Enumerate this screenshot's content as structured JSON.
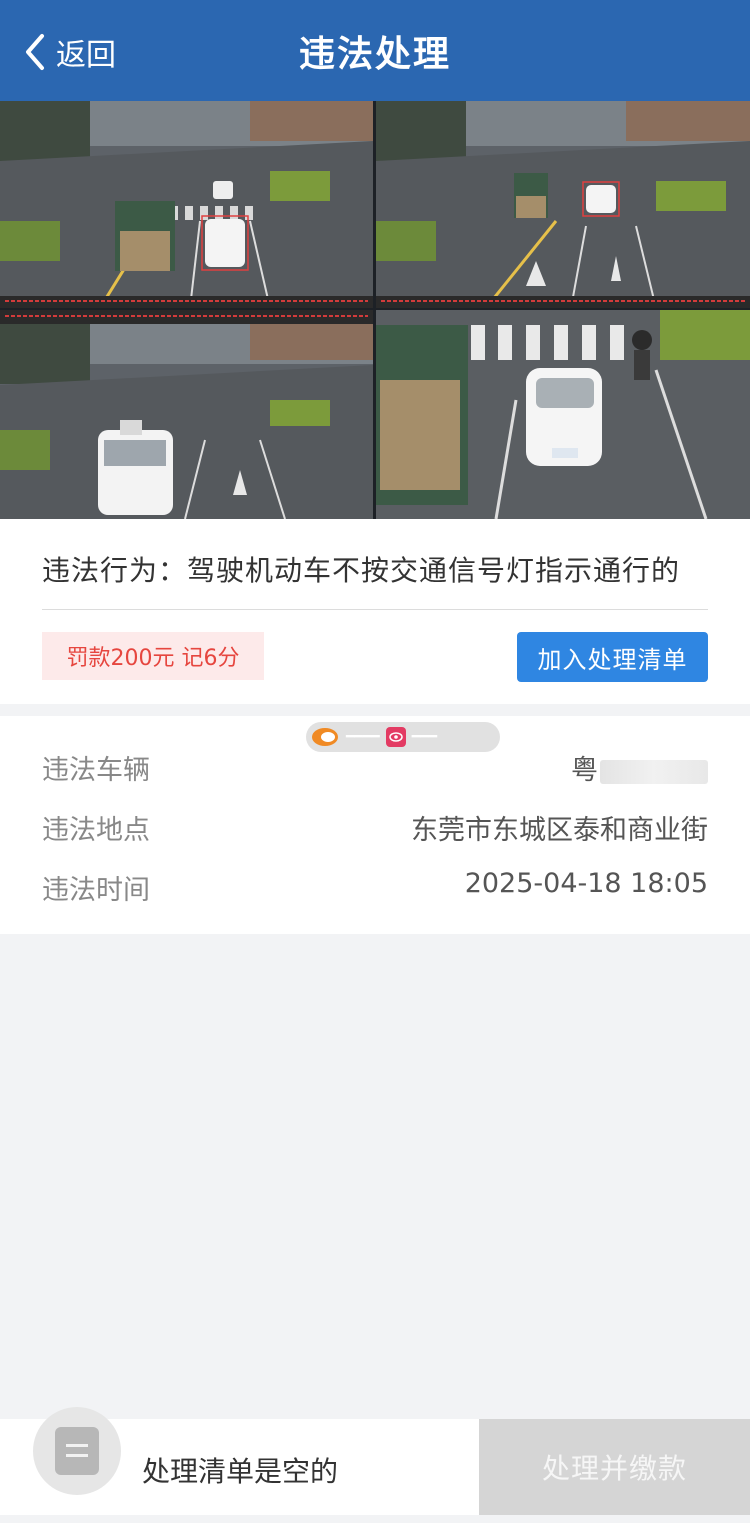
{
  "header": {
    "back_label": "返回",
    "title": "违法处理"
  },
  "photos": {
    "count": 4,
    "active_index": 0
  },
  "violation": {
    "behavior": "违法行为：驾驶机动车不按交通信号灯指示通行的",
    "fine": "罚款200元 记6分",
    "add_button": "加入处理清单"
  },
  "details": {
    "vehicle_label": "违法车辆",
    "vehicle_value": "粤",
    "location_label": "违法地点",
    "location_value": "东莞市东城区泰和商业街",
    "time_label": "违法时间",
    "time_value": "2025-04-18 18:05"
  },
  "bottom": {
    "empty_text": "处理清单是空的",
    "pay_button": "处理并缴款"
  },
  "colors": {
    "header": "#2b67b1",
    "primary_button": "#2f86e2",
    "fine_text": "#e6463f",
    "fine_bg": "#fdeaea",
    "disabled_button": "#d5d5d5"
  }
}
